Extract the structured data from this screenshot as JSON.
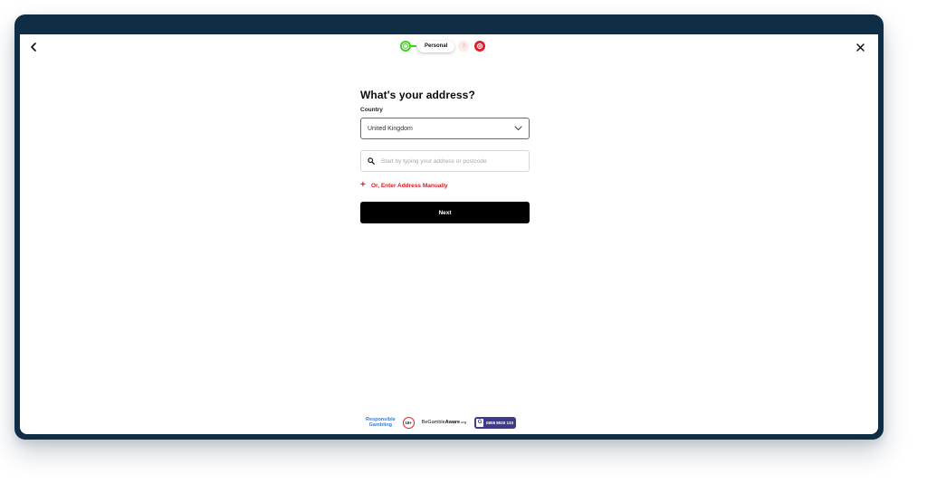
{
  "stepper": {
    "current_label": "Personal",
    "next_number": "3"
  },
  "form": {
    "title": "What's your address?",
    "country_label": "Country",
    "country_value": "United Kingdom",
    "search_placeholder": "Start by typing your address or postcode",
    "manual_label": "Or, Enter Address Manually",
    "next_label": "Next"
  },
  "footer": {
    "responsible_line1": "Responsible",
    "responsible_line2": "Gambling",
    "age_badge": "18+",
    "begambleaware_prefix": "BeGamble",
    "begambleaware_bold": "Aware",
    "begambleaware_suffix": ".org",
    "gamstop_letter": "G",
    "gamstop_phone": "0808 8020 133"
  },
  "colors": {
    "frame": "#0f2d45",
    "accent_red": "#d01f2a",
    "step_done": "#3dd11e",
    "button_bg": "#000000"
  },
  "icons": {
    "back": "chevron-left-icon",
    "close": "close-icon",
    "dropdown": "chevron-down-icon",
    "search": "search-icon",
    "plus": "plus-icon"
  }
}
